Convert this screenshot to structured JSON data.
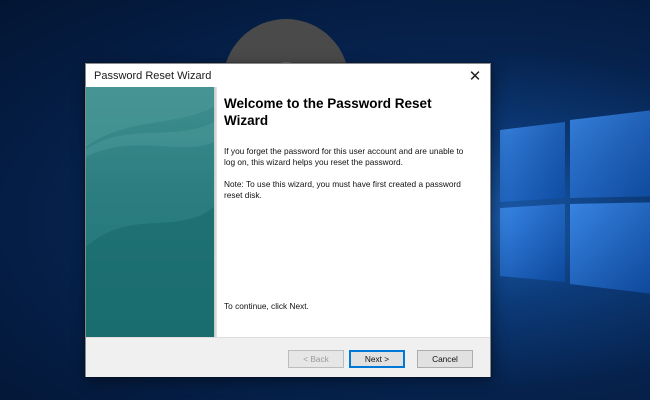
{
  "dialog": {
    "title": "Password Reset Wizard",
    "close_icon": "close-icon",
    "heading": "Welcome to the Password Reset Wizard",
    "description": "If you forget the password for this user account and are unable to log on, this wizard helps you reset the password.",
    "note": "Note: To use this wizard, you must have first created a password reset disk.",
    "continue_text": "To continue, click Next."
  },
  "buttons": {
    "back": "< Back",
    "next": "Next >",
    "cancel": "Cancel"
  },
  "colors": {
    "side_panel": "#2c7e80",
    "accent": "#0078d7",
    "desktop": "#06224d"
  }
}
